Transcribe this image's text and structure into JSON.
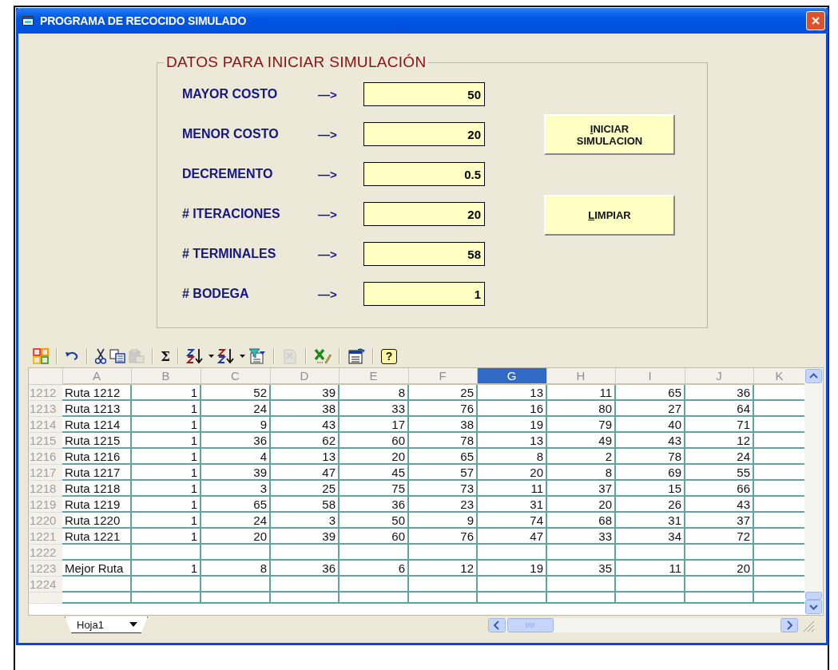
{
  "window": {
    "title": "PROGRAMA DE RECOCIDO SIMULADO"
  },
  "group": {
    "title": "DATOS PARA INICIAR SIMULACIÓN",
    "fields": [
      {
        "label": "MAYOR COSTO",
        "arrow": "—>",
        "value": "50"
      },
      {
        "label": "MENOR COSTO",
        "arrow": "—>",
        "value": "20"
      },
      {
        "label": "DECREMENTO",
        "arrow": "—>",
        "value": "0.5"
      },
      {
        "label": "# ITERACIONES",
        "arrow": "—>",
        "value": "20"
      },
      {
        "label": "# TERMINALES",
        "arrow": "—>",
        "value": "58"
      },
      {
        "label": "# BODEGA",
        "arrow": "—>",
        "value": "1"
      }
    ],
    "buttons": [
      "INICIAR SIMULACION",
      "LIMPIAR"
    ]
  },
  "toolbar": [
    [
      {
        "kind": "office",
        "disabled": false,
        "menu": false
      }
    ],
    [
      {
        "kind": "undo",
        "disabled": false,
        "menu": false
      }
    ],
    [
      {
        "kind": "cut",
        "disabled": false,
        "menu": false
      },
      {
        "kind": "copy",
        "disabled": false,
        "menu": false
      },
      {
        "kind": "paste",
        "disabled": true,
        "menu": false
      }
    ],
    [
      {
        "kind": "text",
        "text": "Σ",
        "disabled": false,
        "menu": false
      }
    ],
    [
      {
        "kind": "sort-asc",
        "disabled": false,
        "menu": true
      },
      {
        "kind": "sort-desc",
        "disabled": false,
        "menu": true
      },
      {
        "kind": "filter",
        "disabled": false,
        "menu": false
      }
    ],
    [
      {
        "kind": "export",
        "disabled": true,
        "menu": false
      }
    ],
    [
      {
        "kind": "excel",
        "disabled": false,
        "menu": false
      }
    ],
    [
      {
        "kind": "window",
        "disabled": false,
        "menu": false
      }
    ],
    [
      {
        "kind": "help",
        "text": "?",
        "disabled": false,
        "menu": false
      }
    ]
  ],
  "sheet": {
    "columns": [
      {
        "label": "A",
        "selected": false
      },
      {
        "label": "B",
        "selected": false
      },
      {
        "label": "C",
        "selected": false
      },
      {
        "label": "D",
        "selected": false
      },
      {
        "label": "E",
        "selected": false
      },
      {
        "label": "F",
        "selected": false
      },
      {
        "label": "G",
        "selected": true
      },
      {
        "label": "H",
        "selected": false
      },
      {
        "label": "I",
        "selected": false
      },
      {
        "label": "J",
        "selected": false
      },
      {
        "label": "K",
        "selected": false
      }
    ],
    "rows": [
      {
        "number": "1212",
        "cells": [
          "Ruta 1212",
          "1",
          "52",
          "39",
          "8",
          "25",
          "13",
          "11",
          "65",
          "36"
        ]
      },
      {
        "number": "1213",
        "cells": [
          "Ruta 1213",
          "1",
          "24",
          "38",
          "33",
          "76",
          "16",
          "80",
          "27",
          "64"
        ]
      },
      {
        "number": "1214",
        "cells": [
          "Ruta 1214",
          "1",
          "9",
          "43",
          "17",
          "38",
          "19",
          "79",
          "40",
          "71"
        ]
      },
      {
        "number": "1215",
        "cells": [
          "Ruta 1215",
          "1",
          "36",
          "62",
          "60",
          "78",
          "13",
          "49",
          "43",
          "12"
        ]
      },
      {
        "number": "1216",
        "cells": [
          "Ruta 1216",
          "1",
          "4",
          "13",
          "20",
          "65",
          "8",
          "2",
          "78",
          "24"
        ]
      },
      {
        "number": "1217",
        "cells": [
          "Ruta 1217",
          "1",
          "39",
          "47",
          "45",
          "57",
          "20",
          "8",
          "69",
          "55"
        ]
      },
      {
        "number": "1218",
        "cells": [
          "Ruta 1218",
          "1",
          "3",
          "25",
          "75",
          "73",
          "11",
          "37",
          "15",
          "66"
        ]
      },
      {
        "number": "1219",
        "cells": [
          "Ruta 1219",
          "1",
          "65",
          "58",
          "36",
          "23",
          "31",
          "20",
          "26",
          "43"
        ]
      },
      {
        "number": "1220",
        "cells": [
          "Ruta 1220",
          "1",
          "24",
          "3",
          "50",
          "9",
          "74",
          "68",
          "31",
          "37"
        ]
      },
      {
        "number": "1221",
        "cells": [
          "Ruta 1221",
          "1",
          "20",
          "39",
          "60",
          "76",
          "47",
          "33",
          "34",
          "72"
        ]
      },
      {
        "number": "1222"
      },
      {
        "number": "1223",
        "cells": [
          "Mejor Ruta",
          "1",
          "8",
          "36",
          "6",
          "12",
          "19",
          "35",
          "11",
          "20"
        ]
      },
      {
        "number": "1224"
      }
    ],
    "tab": "Hoja1"
  }
}
